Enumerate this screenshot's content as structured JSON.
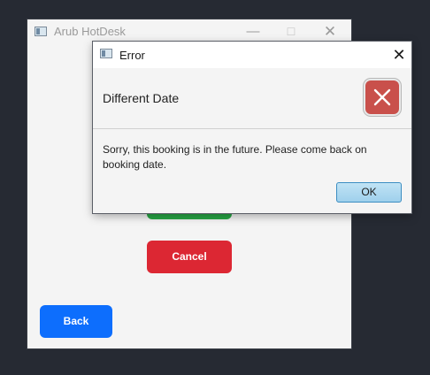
{
  "main_window": {
    "title": "Arub HotDesk",
    "minimize_glyph": "—",
    "maximize_glyph": "☐",
    "close_glyph": "✕",
    "buttons": {
      "confirm_label": "",
      "cancel_label": "Cancel",
      "back_label": "Back"
    }
  },
  "dialog": {
    "title": "Error",
    "close_glyph": "✕",
    "header_text": "Different Date",
    "content_text": "Sorry, this booking is in the future. Please come back on booking date.",
    "ok_label": "OK",
    "icon": "error-x-icon"
  },
  "colors": {
    "desktop": "#262a33",
    "confirm": "#28a745",
    "cancel": "#dc2733",
    "back": "#0d6efd",
    "error_icon": "#c9504b"
  }
}
